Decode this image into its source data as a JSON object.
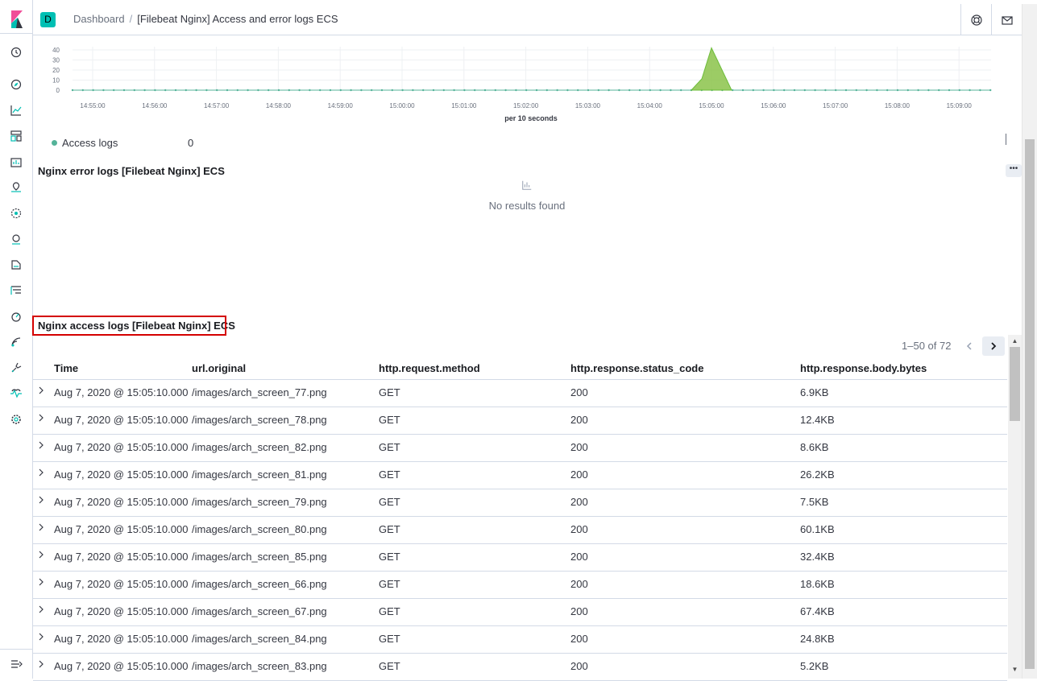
{
  "breadcrumb": {
    "root": "Dashboard",
    "current": "[Filebeat Nginx] Access and error logs ECS"
  },
  "space_initial": "D",
  "chart_data": {
    "type": "area",
    "x": [
      "14:55:00",
      "14:56:00",
      "14:57:00",
      "14:58:00",
      "14:59:00",
      "15:00:00",
      "15:01:00",
      "15:02:00",
      "15:03:00",
      "15:04:00",
      "15:05:00",
      "15:06:00",
      "15:07:00",
      "15:08:00",
      "15:09:00"
    ],
    "y_ticks": [
      "40",
      "30",
      "20",
      "10",
      "0"
    ],
    "xlabel": "per 10 seconds",
    "ylim": [
      0,
      40
    ],
    "peak": {
      "x": "15:05:00",
      "y": 42
    },
    "series": [
      {
        "name": "Access logs",
        "current_value": "0",
        "color": "#54b399"
      }
    ]
  },
  "error_panel": {
    "title": "Nginx error logs [Filebeat Nginx] ECS",
    "empty_text": "No results found"
  },
  "access_panel": {
    "title": "Nginx access logs [Filebeat Nginx] ECS",
    "pagination": "1–50 of 72",
    "columns": [
      "Time",
      "url.original",
      "http.request.method",
      "http.response.status_code",
      "http.response.body.bytes"
    ],
    "rows": [
      [
        "Aug 7, 2020 @ 15:05:10.000",
        "/images/arch_screen_77.png",
        "GET",
        "200",
        "6.9KB"
      ],
      [
        "Aug 7, 2020 @ 15:05:10.000",
        "/images/arch_screen_78.png",
        "GET",
        "200",
        "12.4KB"
      ],
      [
        "Aug 7, 2020 @ 15:05:10.000",
        "/images/arch_screen_82.png",
        "GET",
        "200",
        "8.6KB"
      ],
      [
        "Aug 7, 2020 @ 15:05:10.000",
        "/images/arch_screen_81.png",
        "GET",
        "200",
        "26.2KB"
      ],
      [
        "Aug 7, 2020 @ 15:05:10.000",
        "/images/arch_screen_79.png",
        "GET",
        "200",
        "7.5KB"
      ],
      [
        "Aug 7, 2020 @ 15:05:10.000",
        "/images/arch_screen_80.png",
        "GET",
        "200",
        "60.1KB"
      ],
      [
        "Aug 7, 2020 @ 15:05:10.000",
        "/images/arch_screen_85.png",
        "GET",
        "200",
        "32.4KB"
      ],
      [
        "Aug 7, 2020 @ 15:05:10.000",
        "/images/arch_screen_66.png",
        "GET",
        "200",
        "18.6KB"
      ],
      [
        "Aug 7, 2020 @ 15:05:10.000",
        "/images/arch_screen_67.png",
        "GET",
        "200",
        "67.4KB"
      ],
      [
        "Aug 7, 2020 @ 15:05:10.000",
        "/images/arch_screen_84.png",
        "GET",
        "200",
        "24.8KB"
      ],
      [
        "Aug 7, 2020 @ 15:05:10.000",
        "/images/arch_screen_83.png",
        "GET",
        "200",
        "5.2KB"
      ]
    ]
  },
  "panel_menu_label": "•••",
  "icons": [
    "clock-icon",
    "discover-icon",
    "visualize-icon",
    "dashboard-icon",
    "canvas-icon",
    "maps-icon",
    "ml-icon",
    "siem-icon",
    "logs-icon",
    "apm-icon",
    "uptime-icon",
    "dev-tools-icon",
    "monitoring-icon",
    "management-icon",
    "collapse-icon",
    "help-icon",
    "mail-icon"
  ]
}
